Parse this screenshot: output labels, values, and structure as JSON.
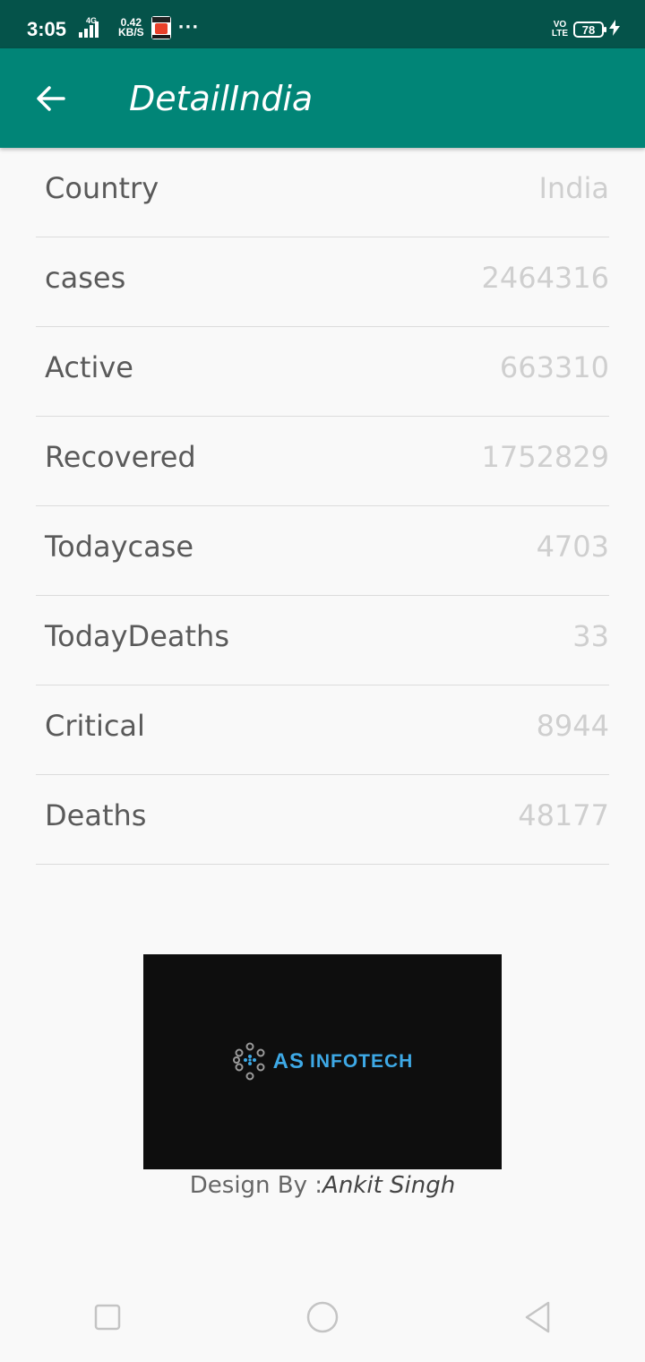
{
  "status_bar": {
    "time": "3:05",
    "network_type": "4G",
    "speed_value": "0.42",
    "speed_unit": "KB/S",
    "more_indicator": "···",
    "volte_top": "VO",
    "volte_bottom": "LTE",
    "battery_level": "78"
  },
  "app_bar": {
    "title": "DetailIndia",
    "background": "#018577"
  },
  "details": [
    {
      "label": "Country",
      "value": "India"
    },
    {
      "label": "cases",
      "value": "2464316"
    },
    {
      "label": "Active",
      "value": "663310"
    },
    {
      "label": "Recovered",
      "value": "1752829"
    },
    {
      "label": "Todaycase",
      "value": "4703"
    },
    {
      "label": "TodayDeaths",
      "value": "33"
    },
    {
      "label": "Critical",
      "value": "8944"
    },
    {
      "label": "Deaths",
      "value": "48177"
    }
  ],
  "logo": {
    "brand": "AS",
    "text": "INFOTECH",
    "accent": "#3ea9e6"
  },
  "credit": {
    "prefix": "Design By :",
    "name": "Ankit Singh"
  },
  "nav": {
    "recents": "square-icon",
    "home": "circle-icon",
    "back": "triangle-back-icon"
  }
}
